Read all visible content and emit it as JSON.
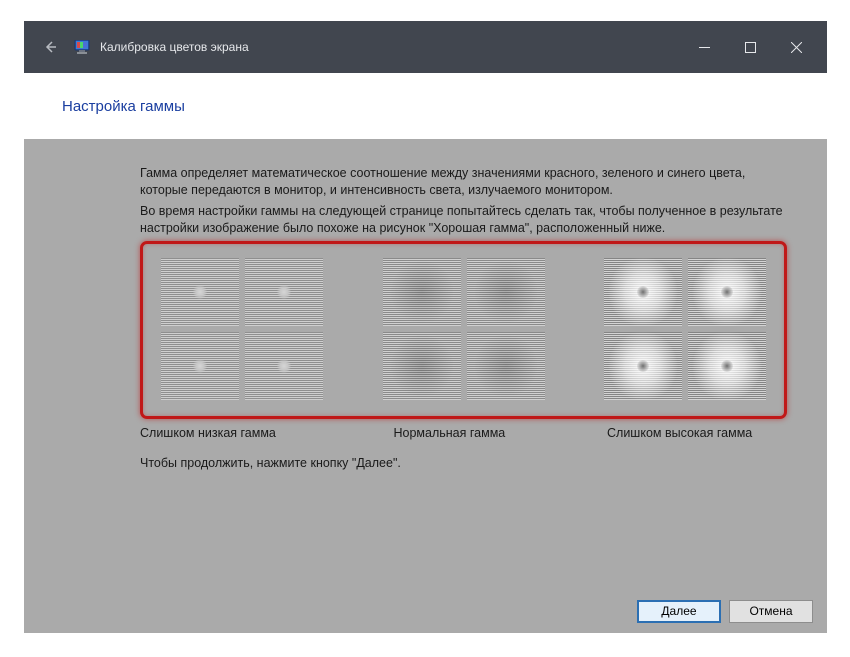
{
  "window": {
    "title": "Калибровка цветов экрана"
  },
  "header": {
    "heading": "Настройка гаммы"
  },
  "body": {
    "p1": "Гамма определяет математическое соотношение между значениями красного, зеленого и синего цвета, которые передаются в монитор, и интенсивность света, излучаемого монитором.",
    "p2": "Во время настройки гаммы на следующей странице попытайтесь сделать так, чтобы полученное в результате настройки изображение было похоже на рисунок \"Хорошая гамма\", расположенный ниже.",
    "labels": {
      "low": "Слишком низкая гамма",
      "normal": "Нормальная гамма",
      "high": "Слишком высокая гамма"
    },
    "continue": "Чтобы продолжить, нажмите кнопку \"Далее\"."
  },
  "footer": {
    "next": "Далее",
    "cancel": "Отмена"
  }
}
